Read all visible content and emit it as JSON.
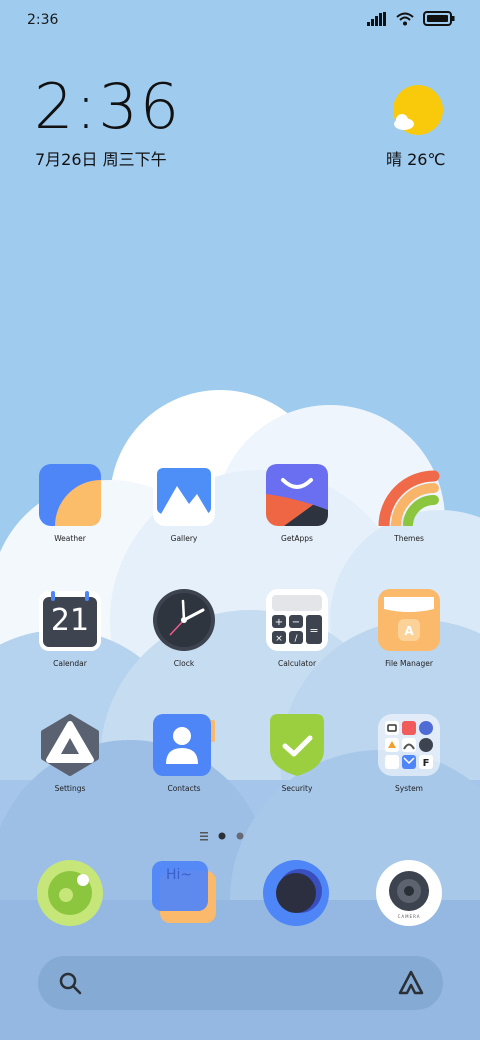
{
  "status_bar": {
    "time": "2:36",
    "icons": [
      "signal-icon",
      "wifi-icon",
      "battery-icon"
    ]
  },
  "clock_widget": {
    "time": "2:36",
    "date": "7月26日 周三下午"
  },
  "weather_widget": {
    "icon": "sun-cloud-icon",
    "text": "晴 26℃"
  },
  "apps": [
    {
      "label": "Weather"
    },
    {
      "label": "Gallery"
    },
    {
      "label": "GetApps"
    },
    {
      "label": "Themes"
    },
    {
      "label": "Calendar",
      "day": "21"
    },
    {
      "label": "Clock"
    },
    {
      "label": "Calculator"
    },
    {
      "label": "File Manager"
    },
    {
      "label": "Settings"
    },
    {
      "label": "Contacts"
    },
    {
      "label": "Security"
    },
    {
      "label": "System"
    }
  ],
  "page_indicator": {
    "pages": 2,
    "current": 1
  },
  "dock": [
    {
      "icon": "phone-app-icon"
    },
    {
      "icon": "messages-app-icon"
    },
    {
      "icon": "browser-app-icon"
    },
    {
      "icon": "camera-app-icon",
      "text": "CAMERA"
    }
  ],
  "search_bar": {
    "left_icon": "search-icon",
    "right_icon": "assistant-icon"
  }
}
